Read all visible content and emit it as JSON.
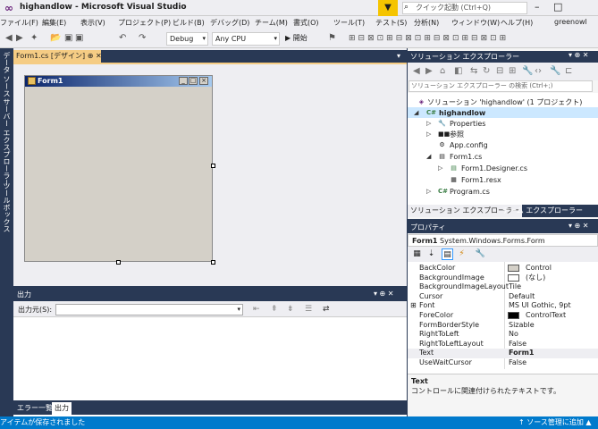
{
  "window": {
    "title": "highandlow - Microsoft Visual Studio",
    "quick_launch_placeholder": "クイック起動 (Ctrl+Q)",
    "user": "greenowl"
  },
  "menu": [
    "ファイル(F)",
    "編集(E)",
    "表示(V)",
    "プロジェクト(P)",
    "ビルド(B)",
    "デバッグ(D)",
    "チーム(M)",
    "書式(O)",
    "ツール(T)",
    "テスト(S)",
    "分析(N)",
    "ウィンドウ(W)",
    "ヘルプ(H)"
  ],
  "toolbar": {
    "config": "Debug",
    "platform": "Any CPU",
    "start": "▶ 開始"
  },
  "left_tabs": [
    "データ ソース",
    "サーバー エクスプローラー",
    "ツールボックス"
  ],
  "doc_tab": {
    "label": "Form1.cs [デザイン]"
  },
  "form": {
    "title": "Form1"
  },
  "output": {
    "header": "出力",
    "source_label": "出力元(S):",
    "source_value": ""
  },
  "bottom_tabs": [
    "エラー一覧",
    "出力"
  ],
  "solution_explorer": {
    "header": "ソリューション エクスプローラー",
    "search_placeholder": "ソリューション エクスプローラー の検索 (Ctrl+;)",
    "tree": [
      {
        "label": "ソリューション 'highandlow' (1 プロジェクト)"
      },
      {
        "label": "highandlow"
      },
      {
        "label": "Properties"
      },
      {
        "label": "参照"
      },
      {
        "label": "App.config"
      },
      {
        "label": "Form1.cs"
      },
      {
        "label": "Form1.Designer.cs"
      },
      {
        "label": "Form1.resx"
      },
      {
        "label": "Program.cs"
      }
    ],
    "tabs": [
      "ソリューション エクスプローラー",
      "チーム エクスプローラー"
    ]
  },
  "properties": {
    "header": "プロパティ",
    "object_name": "Form1",
    "object_type": "System.Windows.Forms.Form",
    "rows": [
      {
        "name": "BackColor",
        "value": "Control"
      },
      {
        "name": "BackgroundImage",
        "value": "(なし)"
      },
      {
        "name": "BackgroundImageLayout",
        "value": "Tile"
      },
      {
        "name": "Cursor",
        "value": "Default"
      },
      {
        "name": "Font",
        "value": "MS UI Gothic, 9pt"
      },
      {
        "name": "ForeColor",
        "value": "ControlText"
      },
      {
        "name": "FormBorderStyle",
        "value": "Sizable"
      },
      {
        "name": "RightToLeft",
        "value": "No"
      },
      {
        "name": "RightToLeftLayout",
        "value": "False"
      },
      {
        "name": "Text",
        "value": "Form1"
      },
      {
        "name": "UseWaitCursor",
        "value": "False"
      }
    ],
    "desc_name": "Text",
    "desc_text": "コントロールに関連付けられたテキストです。"
  },
  "status": {
    "left": "アイテムが保存されました",
    "right": "↑ ソース管理に追加 ▲"
  },
  "colors": {
    "accent": "#007acc",
    "frame": "#293955",
    "tab_active": "#f5cc84"
  }
}
